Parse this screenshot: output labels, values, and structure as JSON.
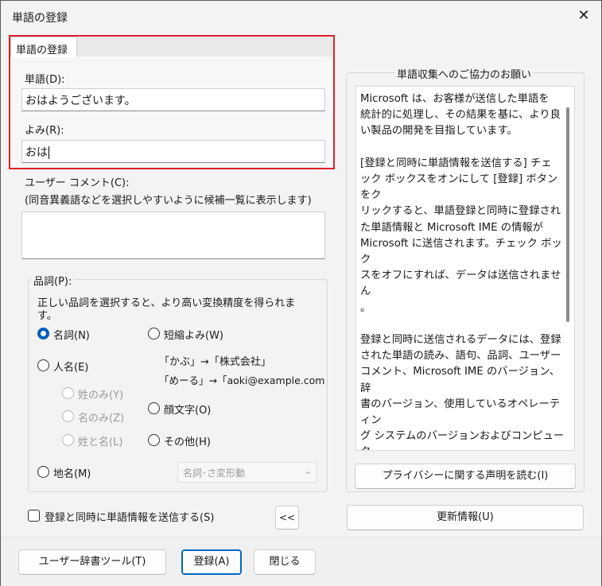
{
  "window": {
    "title": "単語の登録",
    "close_glyph": "✕"
  },
  "tab": {
    "label": "単語の登録"
  },
  "word": {
    "label": "単語(D):",
    "value": "おはようございます。"
  },
  "reading": {
    "label": "よみ(R):",
    "value": "おは"
  },
  "comment": {
    "label": "ユーザー コメント(C):",
    "hint": "(同音異義語などを選択しやすいように候補一覧に表示します)",
    "value": ""
  },
  "pos": {
    "title": "品詞(P):",
    "description": "正しい品詞を選択すると、より高い変換精度を得られます。",
    "options": {
      "noun": {
        "label": "名詞(N)",
        "checked": true
      },
      "abbrev": {
        "label": "短縮よみ(W)"
      },
      "person": {
        "label": "人名(E)"
      },
      "surname": {
        "label": "姓のみ(Y)"
      },
      "given": {
        "label": "名のみ(Z)"
      },
      "fullname": {
        "label": "姓と名(L)"
      },
      "emoticon": {
        "label": "顔文字(O)"
      },
      "other": {
        "label": "その他(H)"
      },
      "place": {
        "label": "地名(M)"
      }
    },
    "examples": [
      "「かぶ」→「株式会社」",
      "「めーる」→「aoki@example.com"
    ],
    "subtype_select": "名詞･さ変形動"
  },
  "send_checkbox": {
    "label": "登録と同時に単語情報を送信する(S)",
    "checked": false
  },
  "collapse_button": "<<",
  "info": {
    "title": "単語収集へのご協力のお願い",
    "text": "Microsoft は、お客様が送信した単語を\n統計的に処理し、その結果を基に、より良\nい製品の開発を目指しています。\n\n[登録と同時に単語情報を送信する] チェ\nック ボックスをオンにして [登録] ボタンをク\nリックすると、単語登録と同時に登録され\nた単語情報と Microsoft IME の情報が\nMicrosoft に送信されます。チェック ボック\nスをオフにすれば、データは送信されません\n。\n\n登録と同時に送信されるデータには、登録\nされた単語の読み、語句、品詞、ユーザー\nコメント、Microsoft IME のバージョン、辞\n書のバージョン、使用しているオペレーティン\nグ システムのバージョンおよびコンピューター\nハードウェアの情報、コンピューターのインター\nネット プロトコル (IP) アドレスが含まれます\n。\n\nお客様特有の情報が収集されたデータに\n含まれることがあります。このような情報が",
    "privacy_button": "プライバシーに関する声明を読む(I)",
    "update_button": "更新情報(U)"
  },
  "footer": {
    "dict_tool_button": "ユーザー辞書ツール(T)",
    "register_button": "登録(A)",
    "close_button": "閉じる"
  },
  "colors": {
    "accent": "#005fb8",
    "highlight_border": "#e0202a",
    "primary_border": "#0067c0"
  }
}
